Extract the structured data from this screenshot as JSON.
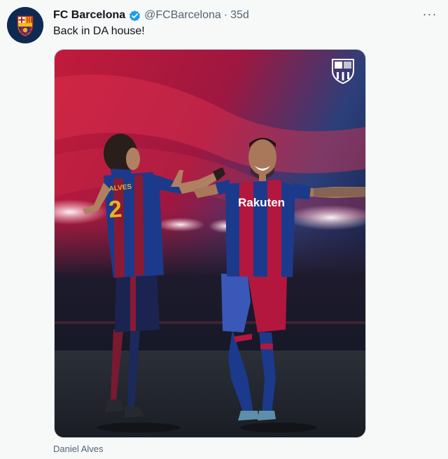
{
  "tweet": {
    "author": {
      "display_name": "FC Barcelona",
      "handle": "@FCBarcelona",
      "verified": true,
      "avatar_icon": "fc-barcelona-crest-icon"
    },
    "separator": "·",
    "timestamp": "35d",
    "more_icon": "more-options-icon",
    "more_label": "···",
    "text": "Back in DA house!",
    "media": {
      "description_icon": "photo-icon",
      "jersey_brand_text": "Rakuten"
    },
    "tagged_user": "Daniel Alves"
  },
  "colors": {
    "name": "#0f1419",
    "secondary": "#536471",
    "verified": "#1d9bf0",
    "background": "#f7f9f9",
    "barca_blue": "#1b3a8c",
    "barca_red": "#b3173e"
  }
}
